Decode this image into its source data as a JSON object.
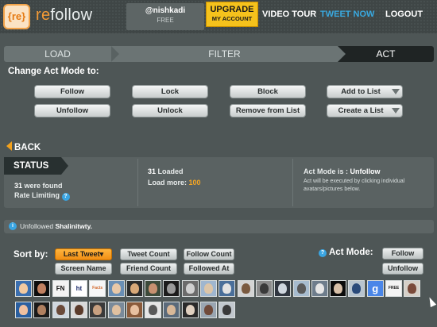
{
  "header": {
    "logo_icon": "{re}",
    "logo_re": "re",
    "logo_rest": "follow",
    "username": "@nishkadi",
    "plan": "FREE",
    "upgrade_line1": "UPGRADE",
    "upgrade_line2": "MY ACCOUNT",
    "nav": [
      "VIDEO TOUR",
      "TWEET NOW",
      "LOGOUT"
    ],
    "accent_color": "#39a9e0",
    "upgrade_color": "#f5c21c"
  },
  "steps": [
    "LOAD",
    "FILTER",
    "ACT"
  ],
  "active_step": "ACT",
  "act_panel": {
    "title": "Change Act Mode to:",
    "buttons": [
      "Follow",
      "Lock",
      "Block",
      "Add to List",
      "Unfollow",
      "Unlock",
      "Remove from List",
      "Create a List"
    ]
  },
  "back_label": "BACK",
  "status": {
    "tab": "STATUS",
    "found_count": "31",
    "found_text": "were found",
    "rate_limit": "Rate Limiting",
    "loaded_count": "31",
    "loaded_text": "Loaded",
    "load_more_label": "Load more:",
    "load_more_value": "100",
    "act_mode_label": "Act Mode is :",
    "act_mode_value": "Unfollow",
    "act_note": "Act will be executed by clicking individual avatars/pictures below."
  },
  "message": {
    "text": "Unfollowed",
    "name": "Shalinitwty."
  },
  "sort": {
    "label": "Sort by:",
    "options": [
      "Last Tweet▾",
      "Tweet Count",
      "Follow Count",
      "Screen Name",
      "Friend Count",
      "Followed At"
    ],
    "active": "Last Tweet"
  },
  "act_mode": {
    "label": "Act Mode:",
    "options": [
      "Follow",
      "Unfollow"
    ]
  },
  "avatars": {
    "row1": [
      {
        "bg": "#3b6fb0",
        "fg": "#f2c9a0",
        "t": ""
      },
      {
        "bg": "#0d0d0d",
        "fg": "#c08060",
        "t": ""
      },
      {
        "bg": "#f2f2f2",
        "fg": "#111111",
        "t": "FN"
      },
      {
        "bg": "#ffffff",
        "fg": "#1b2b6a",
        "t": "ht"
      },
      {
        "bg": "#f6f6f6",
        "fg": "#d36a2e",
        "t": "Facts"
      },
      {
        "bg": "#6a8fb5",
        "fg": "#e8c8a8",
        "t": ""
      },
      {
        "bg": "#2b2b2b",
        "fg": "#d8a878",
        "t": ""
      },
      {
        "bg": "#3d4a3a",
        "fg": "#c89070",
        "t": ""
      },
      {
        "bg": "#1c1c1c",
        "fg": "#9a9a9a",
        "t": ""
      },
      {
        "bg": "#6b6b6b",
        "fg": "#cfcfcf",
        "t": ""
      },
      {
        "bg": "#9fb6cf",
        "fg": "#dcc5a8",
        "t": ""
      },
      {
        "bg": "#4a6f9a",
        "fg": "#e3e3e3",
        "t": ""
      },
      {
        "bg": "#d4d4d4",
        "fg": "#7a5a40",
        "t": ""
      },
      {
        "bg": "#8c8c8c",
        "fg": "#3a3a3a",
        "t": ""
      },
      {
        "bg": "#303640",
        "fg": "#cfd6de",
        "t": ""
      },
      {
        "bg": "#a7bccf",
        "fg": "#5a5a5a",
        "t": ""
      },
      {
        "bg": "#6e7d8c",
        "fg": "#e6e6e6",
        "t": ""
      },
      {
        "bg": "#0b0b0b",
        "fg": "#d8c0a8",
        "t": ""
      },
      {
        "bg": "#b8c4cf",
        "fg": "#2a4a7a",
        "t": ""
      },
      {
        "bg": "#4a86e8",
        "fg": "#ffffff",
        "t": "g"
      },
      {
        "bg": "#f4f4f4",
        "fg": "#222222",
        "t": "FREE"
      },
      {
        "bg": "#d6d0c8",
        "fg": "#7a4a3a",
        "t": ""
      }
    ],
    "row2": [
      {
        "bg": "#2a5fa0",
        "fg": "#f0c0a0",
        "t": ""
      },
      {
        "bg": "#1a1a1a",
        "fg": "#b08060",
        "t": ""
      },
      {
        "bg": "#cfd7df",
        "fg": "#6a4a3a",
        "t": ""
      },
      {
        "bg": "#d9d9d9",
        "fg": "#5a3a2a",
        "t": ""
      },
      {
        "bg": "#3a3a3a",
        "fg": "#c8a080",
        "t": ""
      },
      {
        "bg": "#7a8a9a",
        "fg": "#e0c0a0",
        "t": ""
      },
      {
        "bg": "#8a5a3a",
        "fg": "#e8c0a0",
        "t": ""
      },
      {
        "bg": "#e6e6e6",
        "fg": "#5a5a5a",
        "t": ""
      },
      {
        "bg": "#5a6a7a",
        "fg": "#d8b898",
        "t": ""
      },
      {
        "bg": "#2a2a2a",
        "fg": "#e0d0c0",
        "t": ""
      },
      {
        "bg": "#9aa6b2",
        "fg": "#704a3a",
        "t": ""
      },
      {
        "bg": "#c2c8ce",
        "fg": "#3a3a3a",
        "t": ""
      }
    ]
  }
}
